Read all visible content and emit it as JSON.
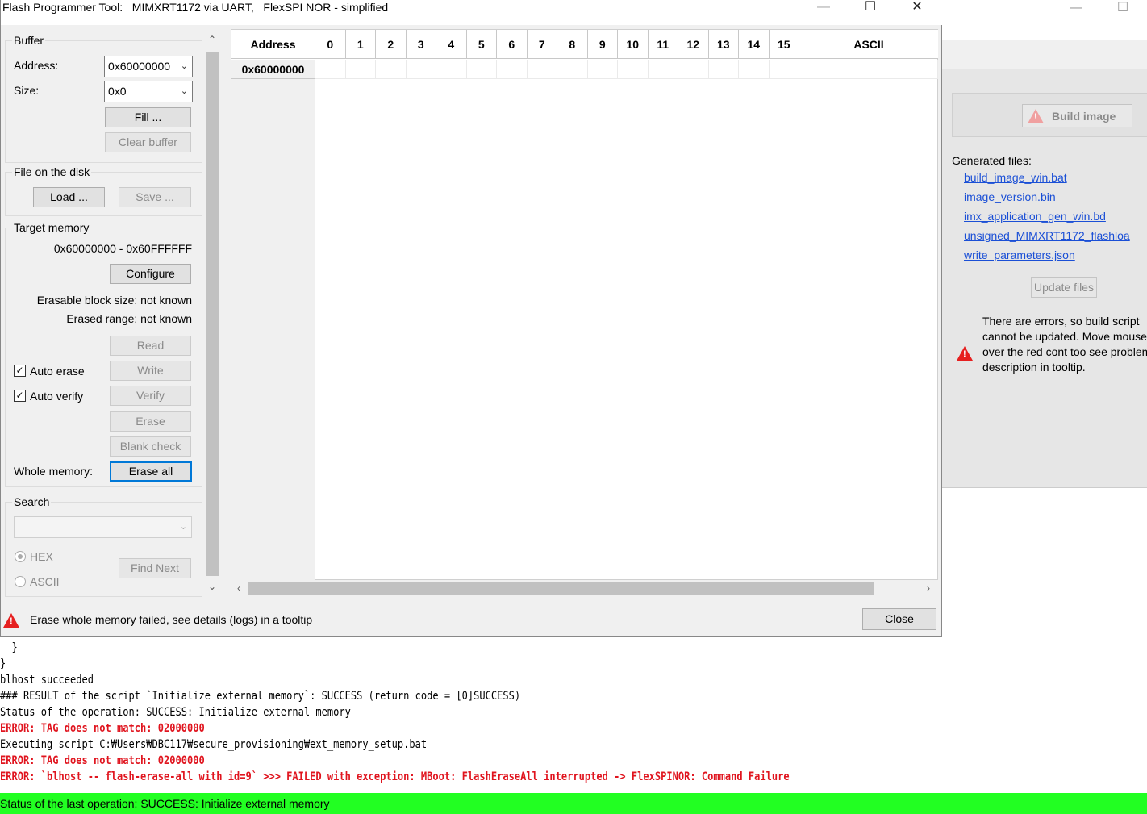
{
  "dialog": {
    "title": "Flash Programmer Tool:   MIMXRT1172 via UART,   FlexSPI NOR - simplified",
    "buffer": {
      "group_label": "Buffer",
      "address_label": "Address:",
      "address_value": "0x60000000",
      "size_label": "Size:",
      "size_value": "0x0",
      "fill_button": "Fill ...",
      "clear_button": "Clear buffer"
    },
    "file": {
      "group_label": "File on the disk",
      "load_button": "Load ...",
      "save_button": "Save ..."
    },
    "target": {
      "group_label": "Target memory",
      "range": "0x60000000 - 0x60FFFFFF",
      "configure_button": "Configure",
      "erasable_block": "Erasable block size: not known",
      "erased_range": "Erased range: not known",
      "read_button": "Read",
      "auto_erase_label": "Auto erase",
      "auto_erase_checked": true,
      "write_button": "Write",
      "auto_verify_label": "Auto verify",
      "auto_verify_checked": true,
      "verify_button": "Verify",
      "erase_button": "Erase",
      "blank_check_button": "Blank check",
      "whole_memory_label": "Whole memory:",
      "erase_all_button": "Erase all"
    },
    "search": {
      "group_label": "Search",
      "value": "",
      "hex_label": "HEX",
      "ascii_label": "ASCII",
      "selected_mode": "HEX",
      "find_next_button": "Find Next"
    },
    "grid": {
      "address_header": "Address",
      "columns": [
        "0",
        "1",
        "2",
        "3",
        "4",
        "5",
        "6",
        "7",
        "8",
        "9",
        "10",
        "11",
        "12",
        "13",
        "14",
        "15"
      ],
      "ascii_header": "ASCII",
      "rows": [
        {
          "address": "0x60000000"
        }
      ]
    },
    "footer": {
      "message": "Erase whole memory failed, see details (logs) in a tooltip",
      "close_button": "Close",
      "error_icon": "warning-triangle-icon"
    }
  },
  "background": {
    "build_button": "Build image",
    "generated_label": "Generated files:",
    "generated_files": [
      "build_image_win.bat",
      "image_version.bin",
      "imx_application_gen_win.bd",
      "unsigned_MIMXRT1172_flashloa",
      "write_parameters.json"
    ],
    "update_button": "Update files",
    "errors_text": "There are errors, so build script cannot be updated. Move mouse over the red cont too see problem description in tooltip."
  },
  "console": {
    "lines": [
      {
        "text": "  }",
        "error": false
      },
      {
        "text": "}",
        "error": false
      },
      {
        "text": "blhost succeeded",
        "error": false
      },
      {
        "text": "### RESULT of the script `Initialize external memory`: SUCCESS (return code = [0]SUCCESS)",
        "error": false
      },
      {
        "text": "Status of the operation: SUCCESS: Initialize external memory",
        "error": false
      },
      {
        "text": "ERROR: TAG does not match: 02000000",
        "error": true
      },
      {
        "text": "Executing script C:₩Users₩DBC117₩secure_provisioning₩ext_memory_setup.bat",
        "error": false
      },
      {
        "text": "ERROR: TAG does not match: 02000000",
        "error": true
      },
      {
        "text": "ERROR: `blhost -- flash-erase-all with id=9` >>> FAILED with exception: MBoot: FlashEraseAll interrupted -> FlexSPINOR: Command Failure",
        "error": true
      }
    ],
    "status": "Status of the last operation: SUCCESS: Initialize external memory"
  },
  "colors": {
    "status_bar": "#22ff22",
    "error_text": "#e0141e",
    "link": "#1a4fd6",
    "focus": "#0078d7"
  }
}
